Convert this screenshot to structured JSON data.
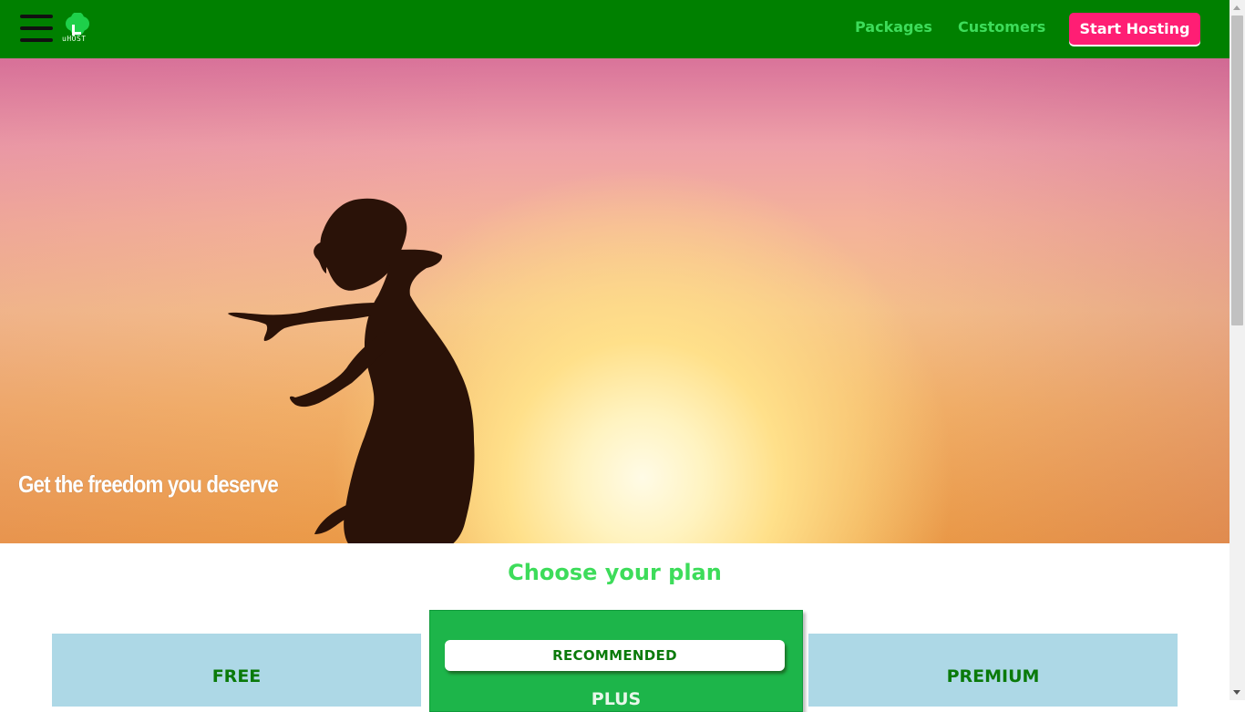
{
  "header": {
    "logo_text": "uHOST",
    "nav": {
      "packages": "Packages",
      "customers": "Customers"
    },
    "cta_label": "Start Hosting"
  },
  "hero": {
    "tagline": "Get the freedom you deserve"
  },
  "plans": {
    "title": "Choose your plan",
    "items": [
      {
        "name": "FREE"
      },
      {
        "badge": "RECOMMENDED",
        "name": "PLUS"
      },
      {
        "name": "PREMIUM"
      }
    ]
  },
  "colors": {
    "header_bg": "#008000",
    "nav_link": "#3ddc5a",
    "cta_bg": "#ff1e74",
    "plan_bg": "#add8e6",
    "plan_highlight_bg": "#1db54a"
  }
}
